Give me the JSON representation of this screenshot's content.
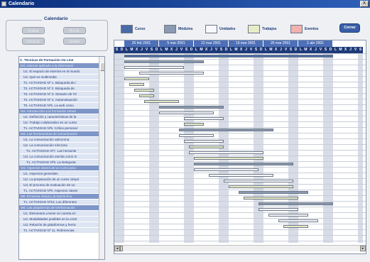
{
  "window": {
    "title": "Calendario",
    "close_label": "X"
  },
  "calendar_box": {
    "title": "Calendario",
    "buttons": [
      "Grabar",
      "Borrar",
      "Sindicar",
      "Grabar"
    ]
  },
  "legend": [
    {
      "label": "Curso",
      "color": "#4a6ba8"
    },
    {
      "label": "Módulos",
      "color": "#8a9ab0"
    },
    {
      "label": "Unidades",
      "color": "#f7f8fb"
    },
    {
      "label": "Trabajos",
      "color": "#e8ecc6"
    },
    {
      "label": "Eventos",
      "color": "#f2b2ad"
    }
  ],
  "close_button": "Cerrar",
  "tree": {
    "root": "C. Técnicas de Formación On Line",
    "rows": [
      {
        "type": "section",
        "text": "M1. Internet aplicado a la informació"
      },
      {
        "type": "item",
        "text": "U1. El espacio de Internet en el mundo"
      },
      {
        "type": "item",
        "text": "U2. Qué es multimedia"
      },
      {
        "type": "item",
        "text": "T1. ACTIVIDAD Nº 1. Búsqueda de i"
      },
      {
        "type": "item",
        "text": "T2. ACTIVIDAD Nº 2. Búsqueda de"
      },
      {
        "type": "item",
        "text": "T3. ACTIVIDAD Nº 3. Glosario de Té"
      },
      {
        "type": "item",
        "text": "T4. ACTIVIDAD Nº 4. Autoevaluación"
      },
      {
        "type": "item",
        "text": "T5. ACTIVIDAD Nº5. La web como"
      },
      {
        "type": "section",
        "text": "M2. Introducción a la formación virtual"
      },
      {
        "type": "item",
        "text": "U1. Definición y características de la"
      },
      {
        "type": "item",
        "text": "U2. Trabajo colaborativo en un curso"
      },
      {
        "type": "item",
        "text": "T1. ACTIVIDAD Nº6. Crítica personal"
      },
      {
        "type": "section",
        "text": "M3. Las herramientas de comunicación"
      },
      {
        "type": "item",
        "text": "U1. La comunicación asíncrona"
      },
      {
        "type": "item",
        "text": "U2. La comunicación síncrona"
      },
      {
        "type": "sub",
        "text": "T1. ACTIVIDAD Nº7. Las herramie"
      },
      {
        "type": "item",
        "text": "U3. La comunicación escrita como m"
      },
      {
        "type": "sub",
        "text": "T1. ACTIVIDAD Nº8. La Netiqueta"
      },
      {
        "type": "section",
        "text": "M4. Aspectos claves de un curso para"
      },
      {
        "type": "item",
        "text": "U1. Aspectos generales"
      },
      {
        "type": "item",
        "text": "U2. La preparación de un curso virtual"
      },
      {
        "type": "item",
        "text": "U3. El proceso de evaluación de un"
      },
      {
        "type": "item",
        "text": "T1. ACTIVIDAD Nº9. Aspectos claves"
      },
      {
        "type": "section",
        "text": "M5. El tutor/a virtual y la tutoría fina"
      },
      {
        "type": "item",
        "text": "T1. ACTIVIDAD Nº10. Los diferentes"
      },
      {
        "type": "section",
        "text": "M6. Las plataformas de teleformación"
      },
      {
        "type": "item",
        "text": "U1. Elementos a tener en cuenta en"
      },
      {
        "type": "item",
        "text": "U2. Modalidades posibles en la contr"
      },
      {
        "type": "item",
        "text": "U3. Relación de plataformas y herra"
      },
      {
        "type": "item",
        "text": "T1. ACTIVIDAD Nº 11. Referencias"
      }
    ]
  },
  "timeline": {
    "weeks": [
      "26 feb 2001",
      "5 mar 2001",
      "12 mar 2001",
      "19 mar 2001",
      "26 mar 2001",
      "2 abr 2001"
    ],
    "days": [
      "S",
      "D",
      "L",
      "M",
      "X",
      "J",
      "V",
      "S",
      "D",
      "L",
      "M",
      "X",
      "J",
      "V",
      "S",
      "D",
      "L",
      "M",
      "X",
      "J",
      "V",
      "S",
      "D",
      "L",
      "M",
      "X",
      "J",
      "V",
      "S",
      "D",
      "L",
      "M",
      "X",
      "J",
      "V",
      "S",
      "D",
      "L",
      "M",
      "X",
      "J",
      "V",
      "S",
      "D",
      "L",
      "M",
      "X",
      "J",
      "V",
      "S"
    ],
    "bars": [
      {
        "row": 0,
        "start": 2,
        "end": 44,
        "kind": "course"
      },
      {
        "row": 1,
        "start": 2,
        "end": 18,
        "kind": "module"
      },
      {
        "row": 2,
        "start": 2,
        "end": 14,
        "kind": "unit"
      },
      {
        "row": 3,
        "start": 5,
        "end": 18,
        "kind": "unit"
      },
      {
        "row": 4,
        "start": 2,
        "end": 7,
        "kind": "task"
      },
      {
        "row": 5,
        "start": 3,
        "end": 6,
        "kind": "task"
      },
      {
        "row": 6,
        "start": 4,
        "end": 8,
        "kind": "task"
      },
      {
        "row": 7,
        "start": 5,
        "end": 8,
        "kind": "task"
      },
      {
        "row": 8,
        "start": 6,
        "end": 13,
        "kind": "task"
      },
      {
        "row": 9,
        "start": 9,
        "end": 22,
        "kind": "module"
      },
      {
        "row": 10,
        "start": 9,
        "end": 20,
        "kind": "unit"
      },
      {
        "row": 11,
        "start": 14,
        "end": 22,
        "kind": "unit"
      },
      {
        "row": 12,
        "start": 14,
        "end": 18,
        "kind": "task"
      },
      {
        "row": 13,
        "start": 13,
        "end": 32,
        "kind": "module"
      },
      {
        "row": 14,
        "start": 13,
        "end": 20,
        "kind": "unit"
      },
      {
        "row": 15,
        "start": 14,
        "end": 22,
        "kind": "unit"
      },
      {
        "row": 16,
        "start": 15,
        "end": 22,
        "kind": "task"
      },
      {
        "row": 17,
        "start": 15,
        "end": 30,
        "kind": "unit"
      },
      {
        "row": 18,
        "start": 16,
        "end": 30,
        "kind": "task"
      },
      {
        "row": 19,
        "start": 16,
        "end": 36,
        "kind": "module"
      },
      {
        "row": 20,
        "start": 16,
        "end": 29,
        "kind": "unit"
      },
      {
        "row": 21,
        "start": 19,
        "end": 32,
        "kind": "unit"
      },
      {
        "row": 22,
        "start": 22,
        "end": 36,
        "kind": "unit"
      },
      {
        "row": 23,
        "start": 23,
        "end": 36,
        "kind": "task"
      },
      {
        "row": 24,
        "start": 25,
        "end": 39,
        "kind": "module"
      },
      {
        "row": 25,
        "start": 26,
        "end": 37,
        "kind": "task"
      },
      {
        "row": 26,
        "start": 29,
        "end": 44,
        "kind": "module"
      },
      {
        "row": 27,
        "start": 29,
        "end": 37,
        "kind": "unit"
      },
      {
        "row": 28,
        "start": 31,
        "end": 39,
        "kind": "unit"
      },
      {
        "row": 29,
        "start": 33,
        "end": 41,
        "kind": "unit"
      },
      {
        "row": 30,
        "start": 34,
        "end": 39,
        "kind": "task"
      }
    ]
  }
}
